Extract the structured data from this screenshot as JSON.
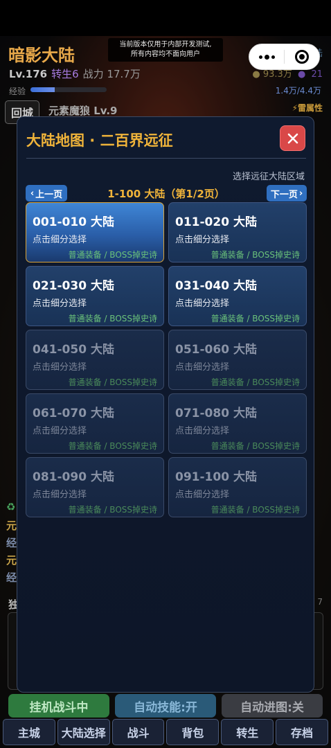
{
  "dev_notice": {
    "line1": "当前版本仅用于内部开发测试,",
    "line2": "所有内容均不面向用户"
  },
  "header": {
    "title": "暗影大陆",
    "level": "Lv.176",
    "rebirth": "转生6",
    "power": "战力 17.7万",
    "exp_label": "经验",
    "exp_value": "1.4万/4.4万",
    "exp_progress": 0.32,
    "gold": "93.3万",
    "gems": "21",
    "corner_text": "陆"
  },
  "monster": {
    "return_label": "回城",
    "name": "元素魔狼 Lv.9",
    "element": "⚡雷属性"
  },
  "background_stats": {
    "line1": "元",
    "line2": "经",
    "line3": "元",
    "line4": "经",
    "icon": "♻",
    "log_label": "独",
    "log_count": "7"
  },
  "modal": {
    "title": "大陆地图 · 二百界远征",
    "subtitle": "选择远征大陆区域",
    "prev_label": "上一页",
    "next_label": "下一页",
    "page_label": "1-100 大陆（第1/2页）",
    "cards": [
      {
        "title": "001-010 大陆",
        "sub": "点击细分选择",
        "note": "普通装备 / BOSS掉史诗"
      },
      {
        "title": "011-020 大陆",
        "sub": "点击细分选择",
        "note": "普通装备 / BOSS掉史诗"
      },
      {
        "title": "021-030 大陆",
        "sub": "点击细分选择",
        "note": "普通装备 / BOSS掉史诗"
      },
      {
        "title": "031-040 大陆",
        "sub": "点击细分选择",
        "note": "普通装备 / BOSS掉史诗"
      },
      {
        "title": "041-050 大陆",
        "sub": "点击细分选择",
        "note": "普通装备 / BOSS掉史诗"
      },
      {
        "title": "051-060 大陆",
        "sub": "点击细分选择",
        "note": "普通装备 / BOSS掉史诗"
      },
      {
        "title": "061-070 大陆",
        "sub": "点击细分选择",
        "note": "普通装备 / BOSS掉史诗"
      },
      {
        "title": "071-080 大陆",
        "sub": "点击细分选择",
        "note": "普通装备 / BOSS掉史诗"
      },
      {
        "title": "081-090 大陆",
        "sub": "点击细分选择",
        "note": "普通装备 / BOSS掉史诗"
      },
      {
        "title": "091-100 大陆",
        "sub": "点击细分选择",
        "note": "普通装备 / BOSS掉史诗"
      }
    ]
  },
  "actions": {
    "battle": "挂机战斗中",
    "auto_skill": "自动技能:开",
    "auto_map": "自动进图:关"
  },
  "nav": [
    "主城",
    "大陆选择",
    "战斗",
    "背包",
    "转生",
    "存档"
  ],
  "colors": {
    "accent_gold": "#f0b43a",
    "close_red": "#d94848",
    "note_green": "#6ac27a",
    "pager_blue": "#2f6fc0"
  }
}
